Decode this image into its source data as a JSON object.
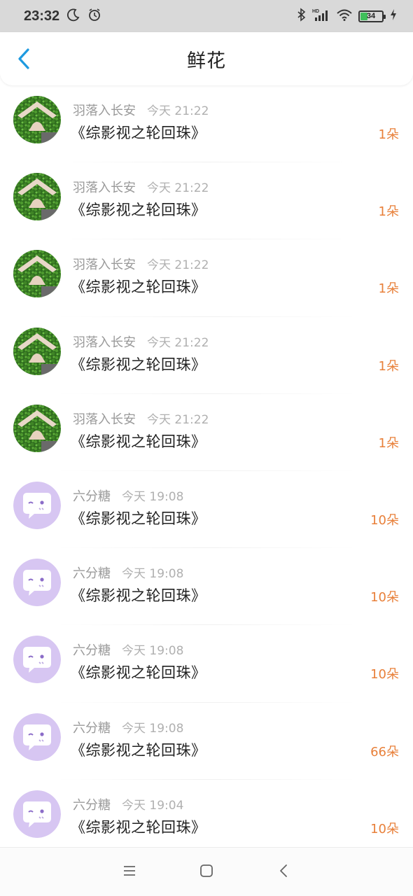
{
  "status_bar": {
    "time": "23:32",
    "battery_level": "34",
    "battery_fraction": 0.34,
    "icons": [
      "moon-icon",
      "alarm-icon",
      "bluetooth-icon",
      "signal-icon",
      "wifi-icon",
      "battery-icon",
      "charging-icon"
    ]
  },
  "header": {
    "title": "鲜花",
    "back_icon": "chevron-left-icon"
  },
  "records": [
    {
      "name": "羽落入长安",
      "time": "今天 21:22",
      "book": "《综影视之轮回珠》",
      "count": "1朵",
      "avatar": "photo-hands-on-grass"
    },
    {
      "name": "羽落入长安",
      "time": "今天 21:22",
      "book": "《综影视之轮回珠》",
      "count": "1朵",
      "avatar": "photo-hands-on-grass"
    },
    {
      "name": "羽落入长安",
      "time": "今天 21:22",
      "book": "《综影视之轮回珠》",
      "count": "1朵",
      "avatar": "photo-hands-on-grass"
    },
    {
      "name": "羽落入长安",
      "time": "今天 21:22",
      "book": "《综影视之轮回珠》",
      "count": "1朵",
      "avatar": "photo-hands-on-grass"
    },
    {
      "name": "羽落入长安",
      "time": "今天 21:22",
      "book": "《综影视之轮回珠》",
      "count": "1朵",
      "avatar": "photo-hands-on-grass"
    },
    {
      "name": "六分糖",
      "time": "今天 19:08",
      "book": "《综影视之轮回珠》",
      "count": "10朵",
      "avatar": "default-chat-bubble-avatar"
    },
    {
      "name": "六分糖",
      "time": "今天 19:08",
      "book": "《综影视之轮回珠》",
      "count": "10朵",
      "avatar": "default-chat-bubble-avatar"
    },
    {
      "name": "六分糖",
      "time": "今天 19:08",
      "book": "《综影视之轮回珠》",
      "count": "10朵",
      "avatar": "default-chat-bubble-avatar"
    },
    {
      "name": "六分糖",
      "time": "今天 19:08",
      "book": "《综影视之轮回珠》",
      "count": "66朵",
      "avatar": "default-chat-bubble-avatar"
    },
    {
      "name": "六分糖",
      "time": "今天 19:04",
      "book": "《综影视之轮回珠》",
      "count": "10朵",
      "avatar": "default-chat-bubble-avatar"
    }
  ],
  "nav_bar": {
    "icons": [
      "menu-icon",
      "home-icon",
      "back-icon"
    ]
  },
  "colors": {
    "accent": "#1E9AE0",
    "count": "#E8803A",
    "avatar_default_bg": "#D7C6F2",
    "status_bar_bg": "#D9D9D9"
  }
}
